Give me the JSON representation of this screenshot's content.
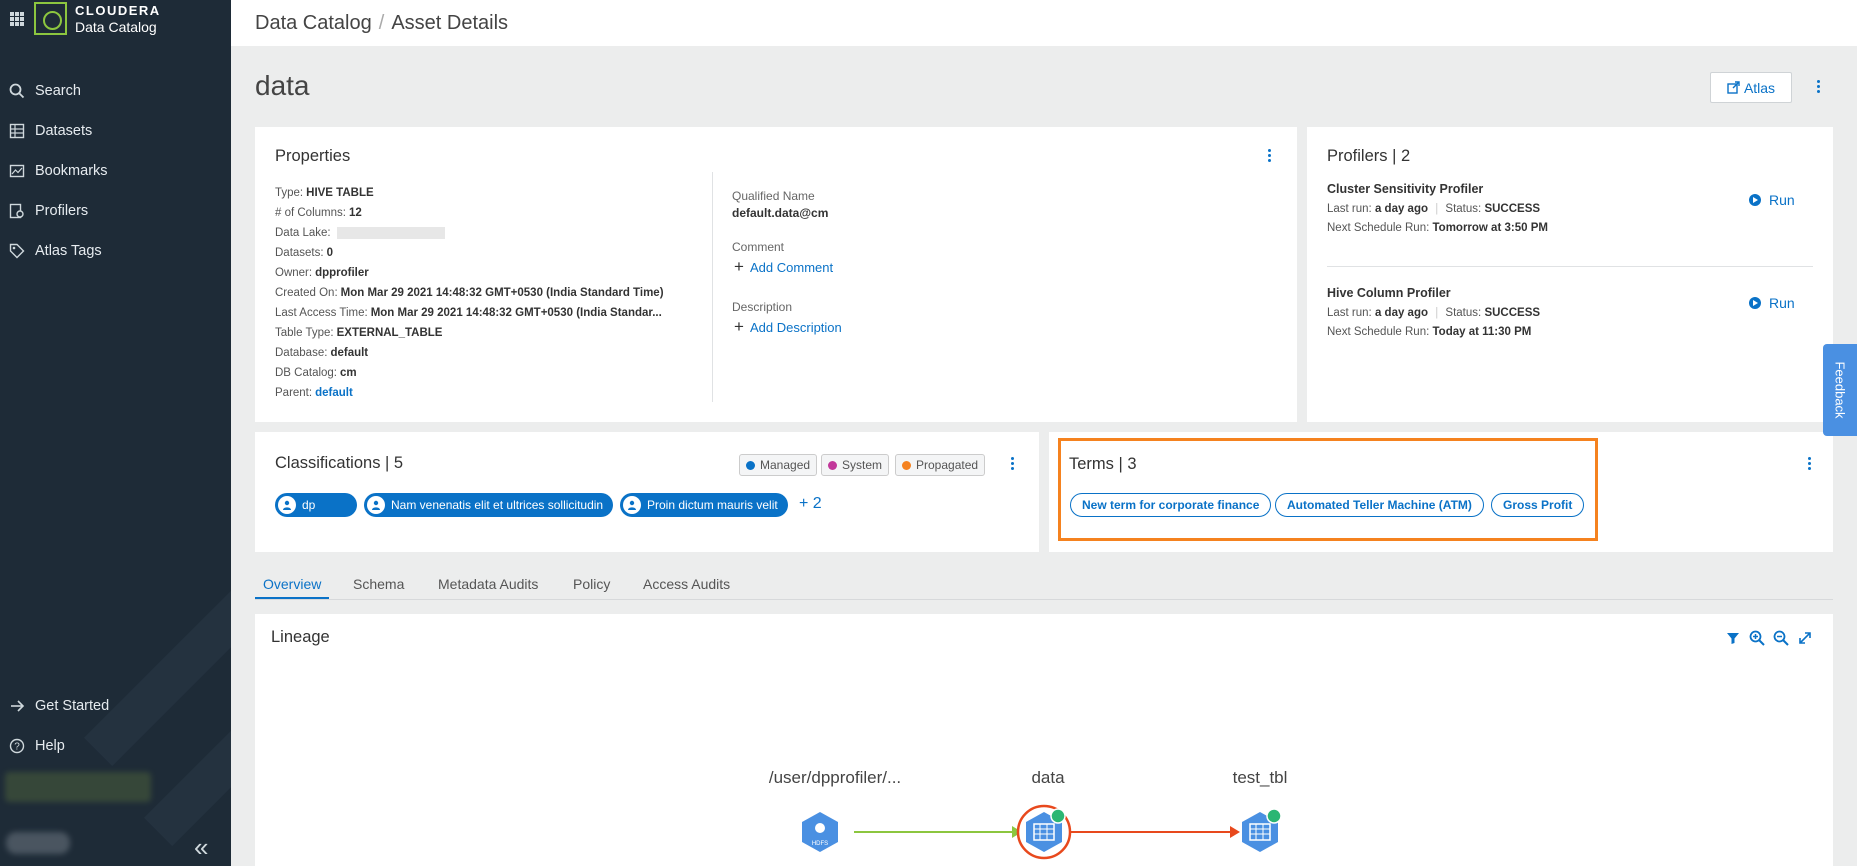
{
  "brand": {
    "name": "CLOUDERA",
    "product": "Data Catalog"
  },
  "sidebar": {
    "items": [
      {
        "label": "Search",
        "icon": "search-icon"
      },
      {
        "label": "Datasets",
        "icon": "datasets-icon"
      },
      {
        "label": "Bookmarks",
        "icon": "bookmarks-icon"
      },
      {
        "label": "Profilers",
        "icon": "profilers-icon"
      },
      {
        "label": "Atlas Tags",
        "icon": "tag-icon"
      }
    ],
    "bottom": [
      {
        "label": "Get Started",
        "icon": "arrow-right-icon"
      },
      {
        "label": "Help",
        "icon": "help-icon"
      }
    ],
    "collapse_glyph": "«"
  },
  "breadcrumb": {
    "root": "Data Catalog",
    "separator": "/",
    "current": "Asset Details"
  },
  "page": {
    "title": "data",
    "atlas_label": "Atlas"
  },
  "properties": {
    "title": "Properties",
    "rows": [
      {
        "label": "Type:",
        "value": "HIVE TABLE"
      },
      {
        "label": "# of Columns:",
        "value": "12"
      },
      {
        "label": "Data Lake:",
        "value": ""
      },
      {
        "label": "Datasets:",
        "value": "0"
      },
      {
        "label": "Owner:",
        "value": "dpprofiler"
      },
      {
        "label": "Created On:",
        "value": "Mon Mar 29 2021 14:48:32 GMT+0530 (India Standard Time)"
      },
      {
        "label": "Last Access Time:",
        "value": "Mon Mar 29 2021 14:48:32 GMT+0530 (India Standar..."
      },
      {
        "label": "Table Type:",
        "value": "EXTERNAL_TABLE"
      },
      {
        "label": "Database:",
        "value": "default"
      },
      {
        "label": "DB Catalog:",
        "value": "cm"
      },
      {
        "label": "Parent:",
        "value": "default"
      }
    ],
    "qualified_name_label": "Qualified Name",
    "qualified_name": "default.data@cm",
    "comment_label": "Comment",
    "add_comment": "Add Comment",
    "description_label": "Description",
    "add_description": "Add Description"
  },
  "profilers": {
    "title": "Profilers | 2",
    "items": [
      {
        "name": "Cluster Sensitivity Profiler",
        "last_run_label": "Last run:",
        "last_run": "a day ago",
        "status_label": "Status:",
        "status": "SUCCESS",
        "next_label": "Next Schedule Run:",
        "next": "Tomorrow at 3:50 PM",
        "run_label": "Run"
      },
      {
        "name": "Hive Column Profiler",
        "last_run_label": "Last run:",
        "last_run": "a day ago",
        "status_label": "Status:",
        "status": "SUCCESS",
        "next_label": "Next Schedule Run:",
        "next": "Today at 11:30 PM",
        "run_label": "Run"
      }
    ]
  },
  "classifications": {
    "title": "Classifications | 5",
    "legend": [
      {
        "label": "Managed",
        "color": "#0a72c7"
      },
      {
        "label": "System",
        "color": "#c2389a"
      },
      {
        "label": "Propagated",
        "color": "#f5821f"
      }
    ],
    "tags": [
      "dp",
      "Nam venenatis elit et ultrices sollicitudin",
      "Proin dictum mauris velit"
    ],
    "more": "+ 2"
  },
  "terms": {
    "title": "Terms | 3",
    "items": [
      "New term for corporate finance",
      "Automated Teller Machine (ATM)",
      "Gross Profit"
    ],
    "highlight_color": "#f5821f"
  },
  "tabs": [
    "Overview",
    "Schema",
    "Metadata Audits",
    "Policy",
    "Access Audits"
  ],
  "active_tab": "Overview",
  "lineage": {
    "title": "Lineage",
    "toolbar": [
      "filter-icon",
      "zoom-in-icon",
      "zoom-out-icon",
      "expand-icon"
    ],
    "nodes": [
      {
        "label": "/user/dpprofiler/...",
        "type": "hdfs",
        "badge": "HDFS"
      },
      {
        "label": "data",
        "type": "table"
      },
      {
        "label": "test_tbl",
        "type": "table"
      }
    ],
    "edge_colors": {
      "input": "#8cc63f",
      "output": "#e8491d"
    }
  },
  "feedback_label": "Feedback"
}
